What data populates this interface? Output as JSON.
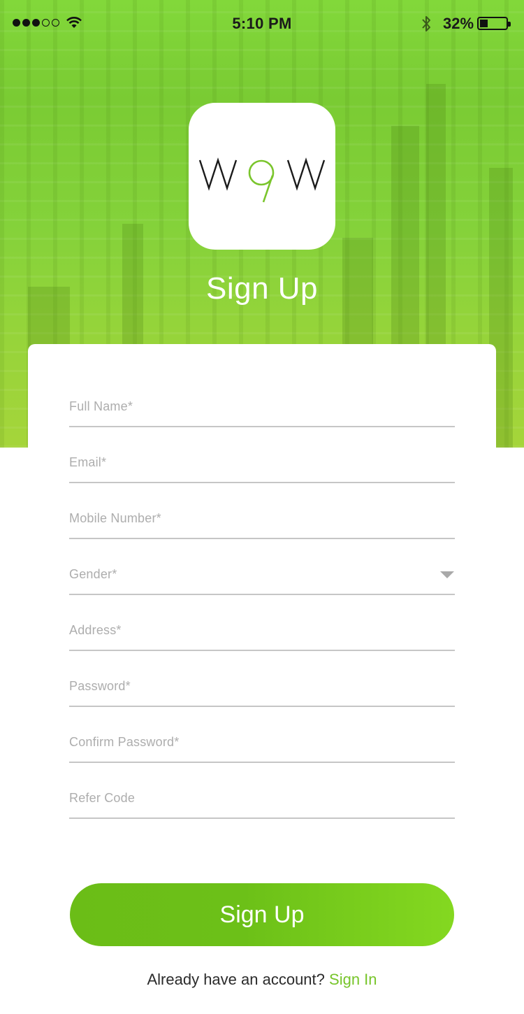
{
  "status_bar": {
    "time": "5:10 PM",
    "battery_percent": "32%",
    "signal_bars_filled": 3,
    "signal_bars_total": 5,
    "battery_level": 0.32
  },
  "brand": {
    "logo_text": "W9W",
    "accent_color": "#7ac52c",
    "button_color": "#6cbf18"
  },
  "header": {
    "title": "Sign Up"
  },
  "form": {
    "fields": [
      {
        "placeholder": "Full Name*"
      },
      {
        "placeholder": "Email*"
      },
      {
        "placeholder": "Mobile Number*"
      },
      {
        "placeholder": "Gender*",
        "icon": "chevron-down-icon"
      },
      {
        "placeholder": "Address*"
      },
      {
        "placeholder": "Password*"
      },
      {
        "placeholder": "Confirm Password*"
      },
      {
        "placeholder": "Refer Code"
      }
    ]
  },
  "actions": {
    "submit_label": "Sign Up"
  },
  "footer": {
    "prompt": "Already have an account?",
    "link_label": "Sign In"
  }
}
